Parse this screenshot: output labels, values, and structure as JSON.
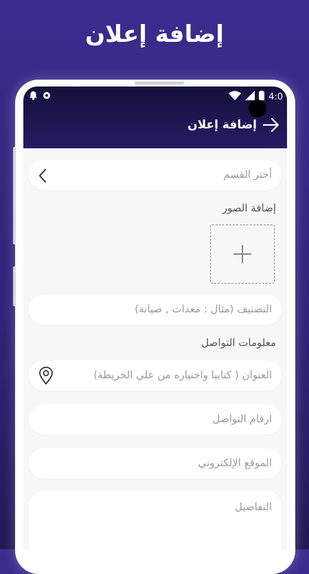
{
  "promo": {
    "title": "إضافة إعلان"
  },
  "status_bar": {
    "time": "4:0"
  },
  "appbar": {
    "title": "إضافة إعلان"
  },
  "form": {
    "category": {
      "placeholder": "أختر القسم"
    },
    "images": {
      "label": "إضافة الصور"
    },
    "classification": {
      "placeholder": "التصنيف (مثال : معدات , صيانة)"
    },
    "contact_section": {
      "label": "معلومات التواصل"
    },
    "address": {
      "placeholder": "العنوان ( كتابيا واختياره من علي الخريطة)"
    },
    "phone": {
      "placeholder": "ارقام التواصل"
    },
    "website": {
      "placeholder": "الموقع الإلكتروني"
    },
    "details": {
      "placeholder": "التفاصيل"
    }
  },
  "icons": {
    "back": "arrow-right-icon",
    "category_chevron": "chevron-left-icon",
    "add_image": "plus-icon",
    "location": "location-pin-icon",
    "notification": "bell-icon",
    "settings": "gear-icon",
    "wifi": "wifi-icon",
    "signal": "signal-icon",
    "battery": "battery-icon"
  },
  "colors": {
    "background": "#2e2478",
    "appbar": "#1c1650",
    "field_bg": "#ffffff",
    "placeholder_text": "#9a9a9a"
  }
}
